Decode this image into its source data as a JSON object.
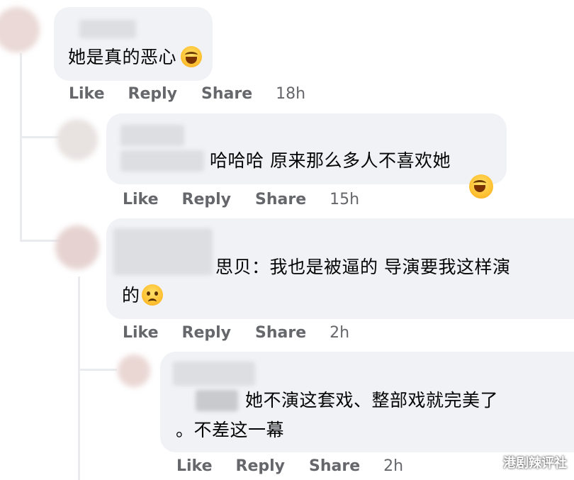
{
  "comments": [
    {
      "text": "她是真的恶心",
      "emoji": "laughing-emoji",
      "actions": {
        "like": "Like",
        "reply": "Reply",
        "share": "Share",
        "time": "18h"
      }
    },
    {
      "text": "哈哈哈 原来那么多人不喜欢她",
      "emoji": "laughing-emoji",
      "actions": {
        "like": "Like",
        "reply": "Reply",
        "share": "Share",
        "time": "15h"
      }
    },
    {
      "text_line1": "思贝：我也是被逼的 导演要我这样演",
      "text_line2": "的",
      "emoji": "pleading-emoji",
      "actions": {
        "like": "Like",
        "reply": "Reply",
        "share": "Share",
        "time": "2h"
      }
    },
    {
      "text_line1": "她不演这套戏、整部戏就完美了",
      "text_line2": "。不差这一幕",
      "actions": {
        "like": "Like",
        "reply": "Reply",
        "share": "Share",
        "time": "2h"
      }
    }
  ],
  "watermark": "港剧辣评社",
  "colors": {
    "bubble": "#f0f2f5",
    "action_text": "#65676b",
    "text": "#050505"
  }
}
